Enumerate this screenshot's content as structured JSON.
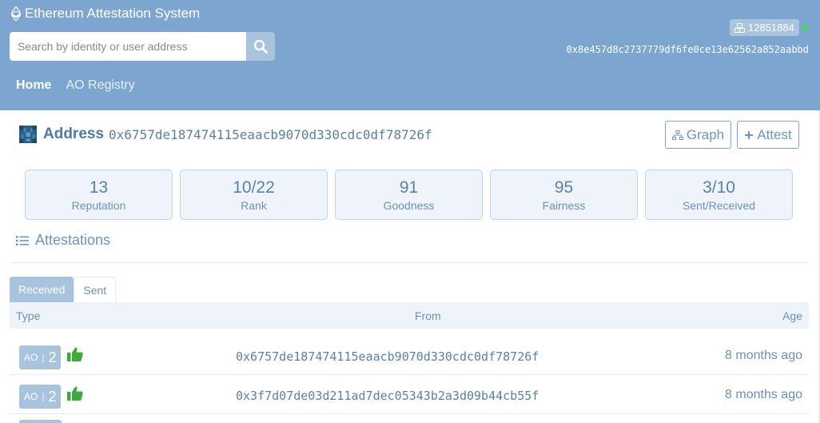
{
  "header": {
    "app_title": "Ethereum Attestation System",
    "search_placeholder": "Search by identity or user address",
    "block_number": "12851884",
    "account_address": "0x8e457d8c2737779df6fe0ce13e62562a852aabbd",
    "nav": [
      {
        "label": "Home",
        "active": true
      },
      {
        "label": "AO Registry",
        "active": false
      }
    ]
  },
  "profile": {
    "label": "Address",
    "address": "0x6757de187474115eaacb9070d330cdc0df78726f",
    "graph_button": "Graph",
    "attest_button": "Attest"
  },
  "stats": [
    {
      "value": "13",
      "label": "Reputation"
    },
    {
      "value": "10/22",
      "label": "Rank"
    },
    {
      "value": "91",
      "label": "Goodness"
    },
    {
      "value": "95",
      "label": "Fairness"
    },
    {
      "value": "3/10",
      "label": "Sent/Received"
    }
  ],
  "attestations": {
    "title": "Attestations",
    "tabs": [
      {
        "label": "Received",
        "active": true
      },
      {
        "label": "Sent",
        "active": false
      }
    ],
    "columns": {
      "type": "Type",
      "from": "From",
      "age": "Age"
    },
    "rows": [
      {
        "ao": "AO",
        "count": "2",
        "from": "0x6757de187474115eaacb9070d330cdc0df78726f",
        "age": "8 months ago"
      },
      {
        "ao": "AO",
        "count": "2",
        "from": "0x3f7d07de03d211ad7dec05343b2a3d09b44cb55f",
        "age": "8 months ago"
      }
    ]
  },
  "colors": {
    "header_bg": "#7ca6cf",
    "accent": "#a7c3dd",
    "thumb_green": "#3daa3d",
    "online_dot": "#3ddc5a"
  },
  "icons": [
    "ethereum-icon",
    "search-icon",
    "cubes-icon",
    "identicon",
    "sitemap-icon",
    "plus-icon",
    "list-icon",
    "thumbs-up-icon"
  ]
}
